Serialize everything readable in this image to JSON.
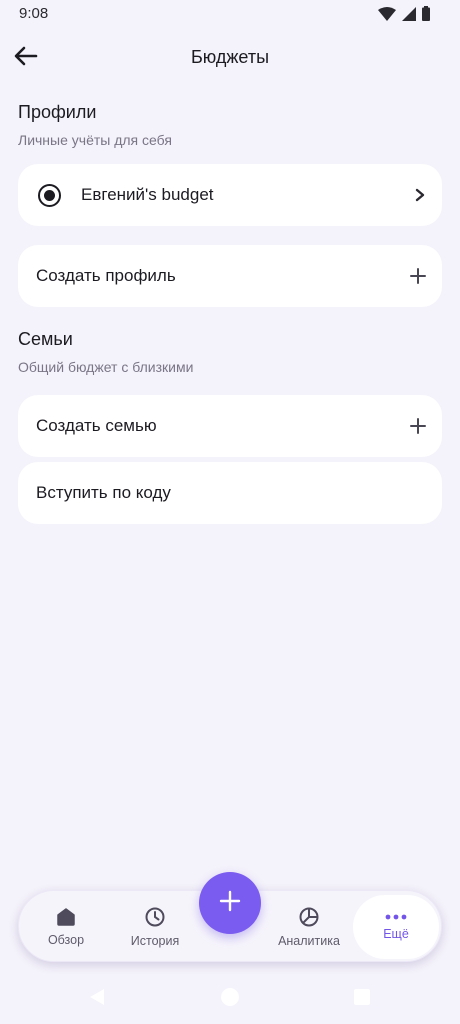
{
  "status_bar": {
    "time": "9:08"
  },
  "header": {
    "title": "Бюджеты"
  },
  "profiles": {
    "title": "Профили",
    "subtitle": "Личные учёты для себя",
    "items": [
      {
        "label": "Евгений's budget",
        "selected": true
      }
    ],
    "create_label": "Создать профиль"
  },
  "families": {
    "title": "Семьи",
    "subtitle": "Общий бюджет с близкими",
    "create_label": "Создать семью",
    "join_label": "Вступить по коду"
  },
  "bottom_nav": {
    "items": [
      {
        "label": "Обзор",
        "icon": "home-icon"
      },
      {
        "label": "История",
        "icon": "clock-icon"
      },
      {
        "label": "Аналитика",
        "icon": "pie-chart-icon"
      },
      {
        "label": "Ещё",
        "icon": "more-dots-icon",
        "active": true
      }
    ],
    "fab_icon": "plus-icon"
  },
  "colors": {
    "background": "#f4f2fa",
    "card": "#ffffff",
    "accent": "#7b5cf0",
    "active_label": "#7356e8",
    "text_primary": "#1d1b22",
    "text_secondary": "#7a7686"
  }
}
